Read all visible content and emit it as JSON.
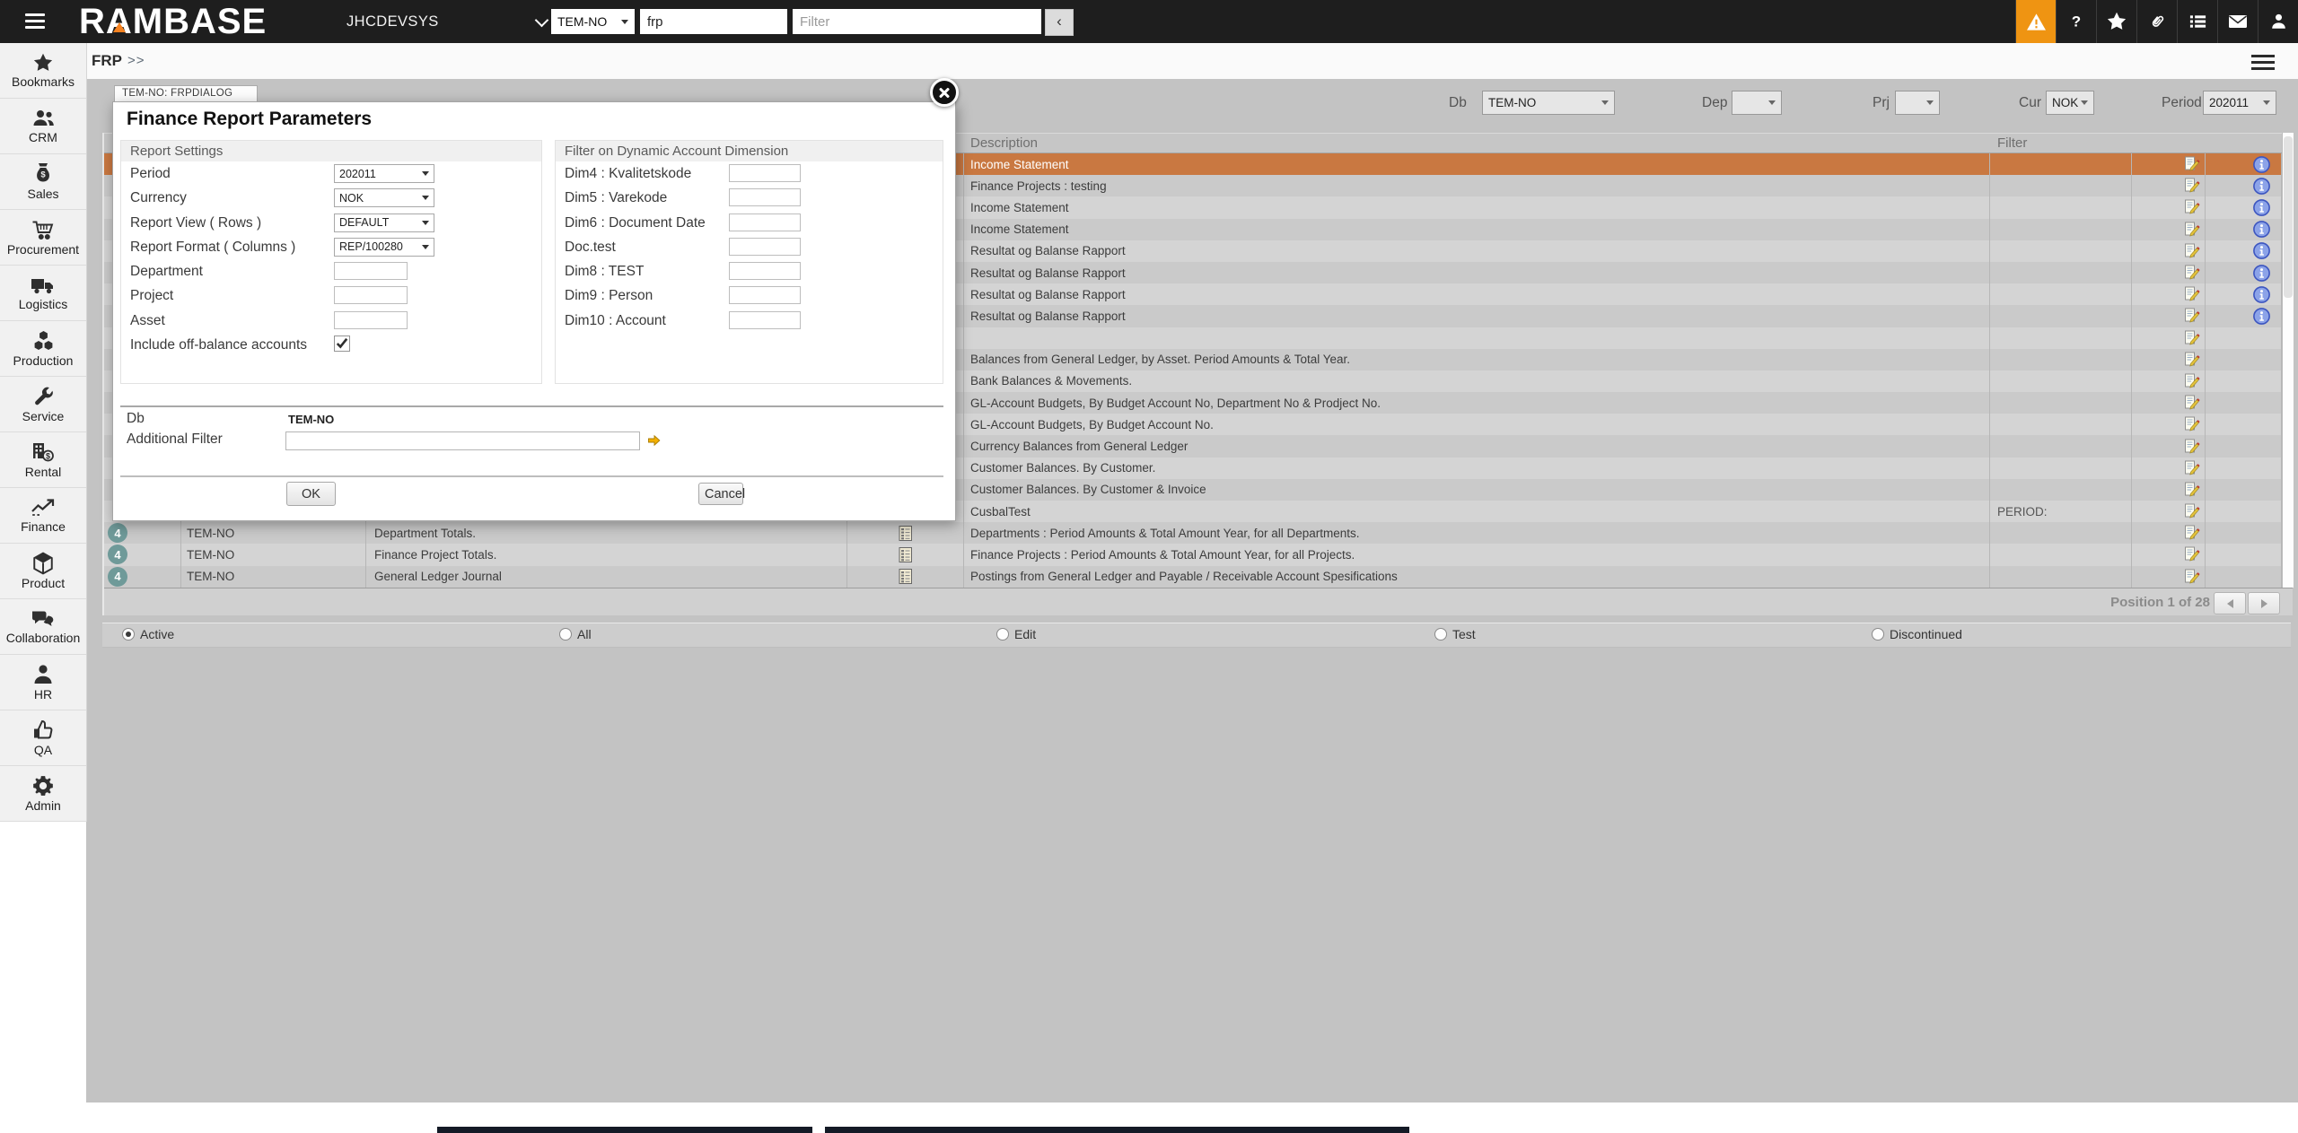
{
  "colors": {
    "topbar_bg": "#1e1e1e",
    "alert_bg": "#ef9412",
    "logo_accent": "#f58220",
    "selected_row": "#c97841",
    "badge_teal": "#6f9a99",
    "info_blue": "#3c55c0",
    "main_bg": "#c3c3c3"
  },
  "topbar": {
    "logo": "RAMBASE",
    "system": "JHCDEVSYS",
    "target_select": "TEM-NO",
    "search_value": "frp",
    "filter_placeholder": "Filter",
    "collapse_label": "‹",
    "icons": [
      {
        "icon": "alert-icon",
        "highlight": true
      },
      {
        "icon": "help-icon",
        "highlight": false
      },
      {
        "icon": "star-icon",
        "highlight": false
      },
      {
        "icon": "paperclip-icon",
        "highlight": false
      },
      {
        "icon": "list-icon",
        "highlight": false
      },
      {
        "icon": "mail-icon",
        "highlight": false
      },
      {
        "icon": "user-icon",
        "highlight": false
      }
    ]
  },
  "breadcrumb": {
    "label": "FRP",
    "chevrons": ">>"
  },
  "sidebar": {
    "items": [
      {
        "icon": "star-icon",
        "label": "Bookmarks"
      },
      {
        "icon": "users-icon",
        "label": "CRM"
      },
      {
        "icon": "moneybag-icon",
        "label": "Sales"
      },
      {
        "icon": "cart-icon",
        "label": "Procurement"
      },
      {
        "icon": "truck-icon",
        "label": "Logistics"
      },
      {
        "icon": "cubes-icon",
        "label": "Production"
      },
      {
        "icon": "wrench-icon",
        "label": "Service"
      },
      {
        "icon": "rental-icon",
        "label": "Rental"
      },
      {
        "icon": "chart-icon",
        "label": "Finance"
      },
      {
        "icon": "cube-icon",
        "label": "Product"
      },
      {
        "icon": "chat-icon",
        "label": "Collaboration"
      },
      {
        "icon": "person-icon",
        "label": "HR"
      },
      {
        "icon": "thumbsup-icon",
        "label": "QA"
      },
      {
        "icon": "gear-icon",
        "label": "Admin"
      }
    ]
  },
  "filterbar": {
    "db_label": "Db",
    "db_value": "TEM-NO",
    "dep_label": "Dep",
    "dep_value": "",
    "prj_label": "Prj",
    "prj_value": "",
    "cur_label": "Cur",
    "cur_value": "NOK",
    "period_label": "Period",
    "period_value": "202011"
  },
  "dialog": {
    "tab": "TEM-NO: FRPDIALOG",
    "title": "Finance Report Parameters",
    "left_section": "Report Settings",
    "right_section": "Filter on Dynamic Account Dimension",
    "left_fields": [
      {
        "label": "Period",
        "type": "select",
        "value": "202011"
      },
      {
        "label": "Currency",
        "type": "select",
        "value": "NOK"
      },
      {
        "label": "Report View ( Rows )",
        "type": "select",
        "value": "DEFAULT"
      },
      {
        "label": "Report Format ( Columns )",
        "type": "select",
        "value": "REP/100280"
      },
      {
        "label": "Department",
        "type": "input",
        "value": ""
      },
      {
        "label": "Project",
        "type": "input",
        "value": ""
      },
      {
        "label": "Asset",
        "type": "input",
        "value": ""
      },
      {
        "label": "Include off-balance accounts",
        "type": "checkbox",
        "checked": true
      }
    ],
    "right_fields": [
      {
        "label": "Dim4 : Kvalitetskode",
        "value": ""
      },
      {
        "label": "Dim5 : Varekode",
        "value": ""
      },
      {
        "label": "Dim6 : Document Date",
        "value": ""
      },
      {
        "label": "Doc.test",
        "value": ""
      },
      {
        "label": "Dim8 : TEST",
        "value": ""
      },
      {
        "label": "Dim9 : Person",
        "value": ""
      },
      {
        "label": "Dim10 : Account",
        "value": ""
      }
    ],
    "db_label": "Db",
    "db_value": "TEM-NO",
    "additional_filter_label": "Additional Filter",
    "additional_filter_value": "",
    "ok_label": "OK",
    "cancel_label": "Cancel"
  },
  "table": {
    "columns": {
      "description": "Description",
      "filter": "Filter"
    },
    "rows": [
      {
        "description": "Income Statement",
        "filter": "",
        "selected": true,
        "edit": true,
        "info": true,
        "left": null
      },
      {
        "description": "Finance Projects : testing",
        "filter": "",
        "selected": false,
        "edit": true,
        "info": true,
        "left": null
      },
      {
        "description": "Income Statement",
        "filter": "",
        "selected": false,
        "edit": true,
        "info": true,
        "left": null
      },
      {
        "description": "Income Statement",
        "filter": "",
        "selected": false,
        "edit": true,
        "info": true,
        "left": null
      },
      {
        "description": "Resultat og Balanse Rapport",
        "filter": "",
        "selected": false,
        "edit": true,
        "info": true,
        "left": null
      },
      {
        "description": "Resultat og Balanse Rapport",
        "filter": "",
        "selected": false,
        "edit": true,
        "info": true,
        "left": null
      },
      {
        "description": "Resultat og Balanse Rapport",
        "filter": "",
        "selected": false,
        "edit": true,
        "info": true,
        "left": null
      },
      {
        "description": "Resultat og Balanse Rapport",
        "filter": "",
        "selected": false,
        "edit": true,
        "info": true,
        "left": null
      },
      {
        "description": "",
        "filter": "",
        "selected": false,
        "edit": true,
        "info": false,
        "left": null
      },
      {
        "description": "Balances from General Ledger, by Asset. Period Amounts & Total Year.",
        "filter": "",
        "selected": false,
        "edit": true,
        "info": false,
        "left": null
      },
      {
        "description": "Bank Balances & Movements.",
        "filter": "",
        "selected": false,
        "edit": true,
        "info": false,
        "left": null
      },
      {
        "description": "GL-Account Budgets, By Budget Account No, Department No & Prodject No.",
        "filter": "",
        "selected": false,
        "edit": true,
        "info": false,
        "left": null
      },
      {
        "description": "GL-Account Budgets, By Budget Account No.",
        "filter": "",
        "selected": false,
        "edit": true,
        "info": false,
        "left": null
      },
      {
        "description": "Currency Balances from General Ledger",
        "filter": "",
        "selected": false,
        "edit": true,
        "info": false,
        "left": null
      },
      {
        "description": "Customer Balances. By Customer.",
        "filter": "",
        "selected": false,
        "edit": true,
        "info": false,
        "left": null
      },
      {
        "description": "Customer Balances. By Customer & Invoice",
        "filter": "",
        "selected": false,
        "edit": true,
        "info": false,
        "left": null
      },
      {
        "description": "CusbalTest",
        "filter": "PERIOD:",
        "selected": false,
        "edit": true,
        "info": false,
        "left": null
      },
      {
        "description": "Departments : Period Amounts & Total Amount Year, for all Departments.",
        "filter": "",
        "selected": false,
        "edit": true,
        "info": false,
        "left": {
          "badge": "4",
          "db": "TEM-NO",
          "name": "Department Totals.",
          "grid": true
        }
      },
      {
        "description": "Finance Projects : Period Amounts & Total Amount Year, for all Projects.",
        "filter": "",
        "selected": false,
        "edit": true,
        "info": false,
        "left": {
          "badge": "4",
          "db": "TEM-NO",
          "name": "Finance Project Totals.",
          "grid": true
        }
      },
      {
        "description": "Postings from General Ledger and Payable / Receivable Account Spesifications",
        "filter": "",
        "selected": false,
        "edit": true,
        "info": false,
        "left": {
          "badge": "4",
          "db": "TEM-NO",
          "name": "General Ledger Journal",
          "grid": true
        }
      }
    ],
    "pagination": {
      "position": "Position 1 of 28"
    }
  },
  "status_filters": {
    "options": [
      {
        "label": "Active",
        "selected": true
      },
      {
        "label": "All",
        "selected": false
      },
      {
        "label": "Edit",
        "selected": false
      },
      {
        "label": "Test",
        "selected": false
      },
      {
        "label": "Discontinued",
        "selected": false
      }
    ]
  }
}
